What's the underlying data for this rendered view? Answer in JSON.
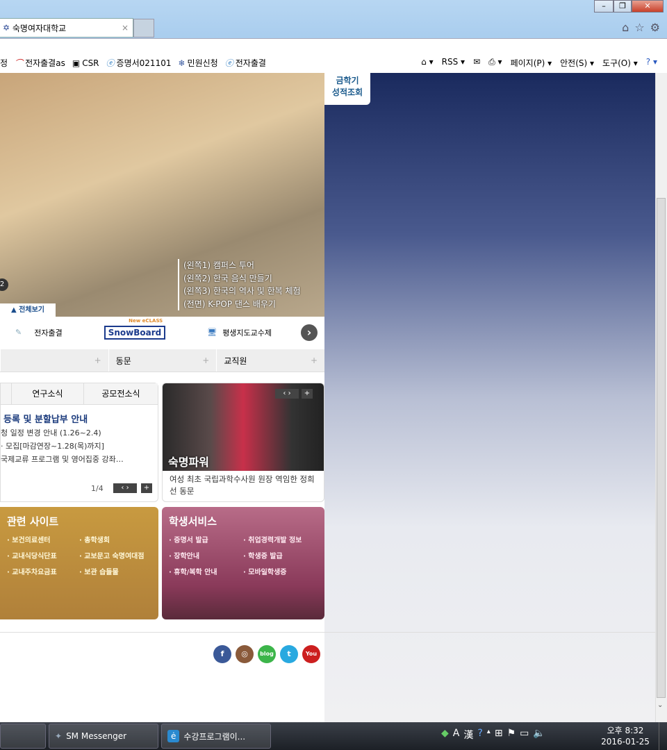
{
  "browser": {
    "tab_title": "숙명여자대학교",
    "tab_close": "×",
    "window_buttons": [
      "–",
      "❐",
      "✕"
    ],
    "toolbar_icons": [
      "home-icon",
      "star-icon",
      "gear-icon"
    ]
  },
  "favorites": [
    "정",
    "전자출결as",
    "CSR",
    "증명서021101",
    "민원신청",
    "전자출결"
  ],
  "commands": [
    "⌂ ▾",
    "RSS ▾",
    "✉",
    "⎙ ▾",
    "페이지(P) ▾",
    "안전(S) ▾",
    "도구(O) ▾",
    "? ▾"
  ],
  "hero": {
    "captions": [
      "(왼쪽1) 캠퍼스 투어",
      "(왼쪽2) 한국 음식 만들기",
      "(왼쪽3) 한국의 역사 및 한복 체험",
      "(전면) K-POP 댄스 배우기"
    ],
    "slide_num": "2",
    "view_all": "▲ 전체보기",
    "grade_tab": [
      "금학기",
      "성적조회"
    ]
  },
  "quick": {
    "items": [
      "전자출결",
      "평생지도교수제"
    ],
    "snow_tag": "New eCLASS",
    "snow_logo": "SnowBoard",
    "next": "›"
  },
  "accordion": [
    {
      "label": "",
      "plus": "+"
    },
    {
      "label": "동문",
      "plus": "+"
    },
    {
      "label": "교직원",
      "plus": "+"
    }
  ],
  "news": {
    "tabs": [
      "",
      "연구소식",
      "공모전소식"
    ],
    "headline": "등록 및 분할납부 안내",
    "items": [
      "청 일정 변경 안내 (1.26~2.4)",
      "· 모집[마감연장~1.28(목)까지]",
      "국제교류 프로그램 및 영어집중 강좌…"
    ],
    "page": "1/4"
  },
  "power": {
    "title": "숙명파워",
    "desc": "여성 최초 국립과학수사원 원장 역임한 정희선 동문"
  },
  "related": {
    "title": "관련 사이트",
    "links": [
      "보건의료센터",
      "총학생회",
      "교내식당식단표",
      "교보문고 숙명여대점",
      "교내주차요금표",
      "보관 습들물"
    ]
  },
  "student": {
    "title": "학생서비스",
    "links": [
      "증명서 발급",
      "취업경력개발 정보",
      "장학안내",
      "학생증 발급",
      "휴학/복학 안내",
      "모바일학생증"
    ]
  },
  "social": [
    {
      "label": "f",
      "color": "#3b5998"
    },
    {
      "label": "◎",
      "color": "#8a5a3a"
    },
    {
      "label": "blog",
      "color": "#3cb54a"
    },
    {
      "label": "t",
      "color": "#29a9e0"
    },
    {
      "label": "You",
      "color": "#cc1f1f"
    }
  ],
  "taskbar": {
    "apps": [
      "SM Messenger",
      "수강프로그램이..."
    ],
    "time": "오후 8:32",
    "date": "2016-01-25",
    "tray": [
      "A",
      "漢",
      "?"
    ]
  }
}
